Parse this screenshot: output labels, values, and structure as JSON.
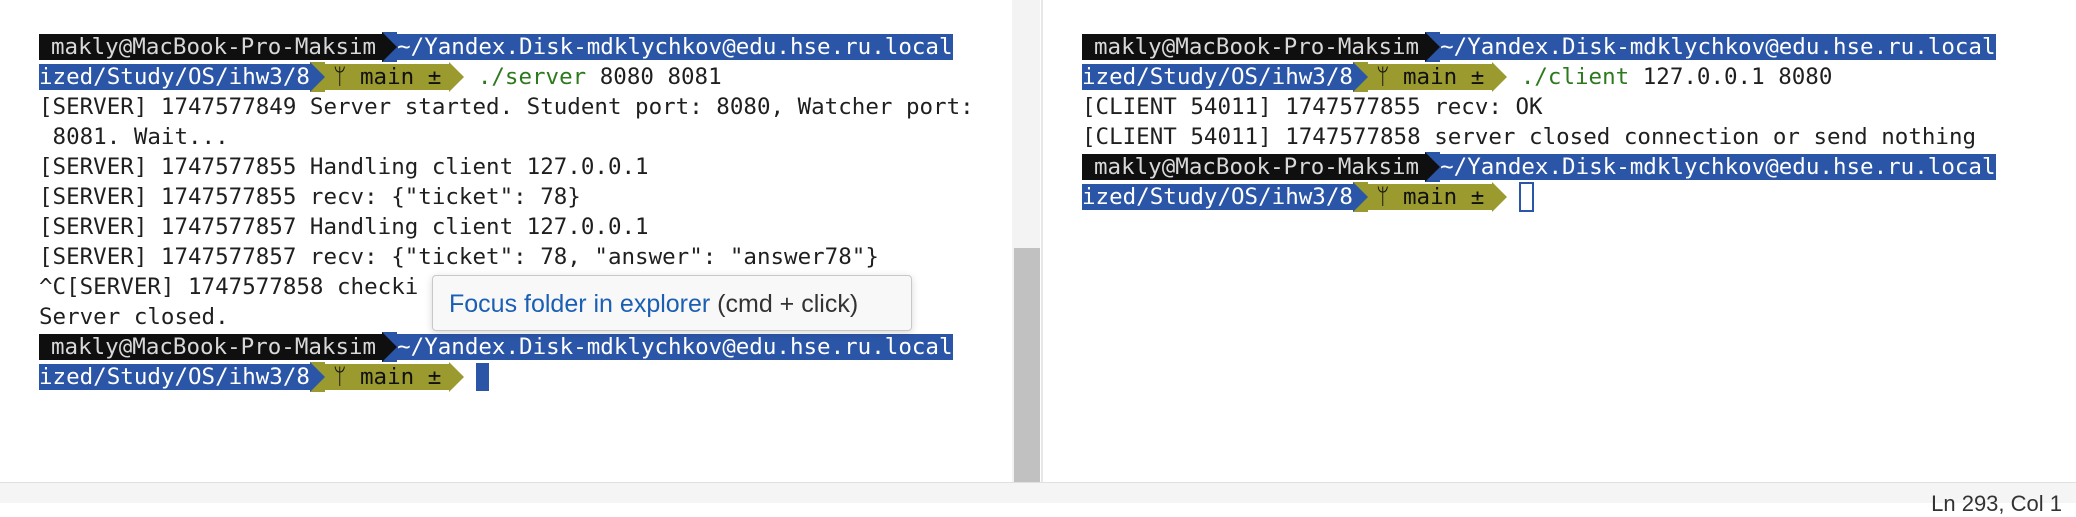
{
  "left_terminal": {
    "prompt1": {
      "user": "makly@MacBook-Pro-Maksim",
      "path_part1": "~/Yandex.Disk-mdklychkov@edu.hse.ru.local",
      "path_part2": "ized/Study/OS/ihw3/8",
      "branch": "main ±",
      "command": "./server",
      "args": "8080 8081"
    },
    "output": [
      "[SERVER] 1747577849 Server started. Student port: 8080, Watcher port:",
      " 8081. Wait...",
      "[SERVER] 1747577855 Handling client 127.0.0.1",
      "[SERVER] 1747577855 recv: {\"ticket\": 78}",
      "[SERVER] 1747577857 Handling client 127.0.0.1",
      "[SERVER] 1747577857 recv: {\"ticket\": 78, \"answer\": \"answer78\"}",
      "^C[SERVER] 1747577858 checki",
      "Server closed."
    ],
    "prompt2": {
      "user": "makly@MacBook-Pro-Maksim",
      "path_part1": "~/Yandex.Disk-mdklychkov@edu.hse.ru.local",
      "path_part2": "ized/Study/OS/ihw3/8",
      "branch": "main ±"
    }
  },
  "right_terminal": {
    "prompt1": {
      "user": "makly@MacBook-Pro-Maksim",
      "path_part1": "~/Yandex.Disk-mdklychkov@edu.hse.ru.local",
      "path_part2": "ized/Study/OS/ihw3/8",
      "branch": "main ±",
      "command": "./client",
      "args": "127.0.0.1 8080"
    },
    "output": [
      "[CLIENT 54011] 1747577855 recv: OK",
      "[CLIENT 54011] 1747577858 server closed connection or send nothing"
    ],
    "prompt2": {
      "user": "makly@MacBook-Pro-Maksim",
      "path_part1": "~/Yandex.Disk-mdklychkov@edu.hse.ru.local",
      "path_part2": "ized/Study/OS/ihw3/8",
      "branch": "main ±"
    }
  },
  "tooltip": {
    "link": "Focus folder in explorer",
    "hint": " (cmd + click)"
  },
  "statusbar": {
    "position": "Ln 293, Col 1"
  },
  "colors": {
    "prompt_user_bg": "#0f0f0f",
    "prompt_path_bg": "#2b55a7",
    "prompt_git_bg": "#9a9a2e",
    "command_green": "#2d7a1e",
    "link_blue": "#1a5fb4"
  },
  "icons": {
    "branch": "git-branch-icon"
  }
}
